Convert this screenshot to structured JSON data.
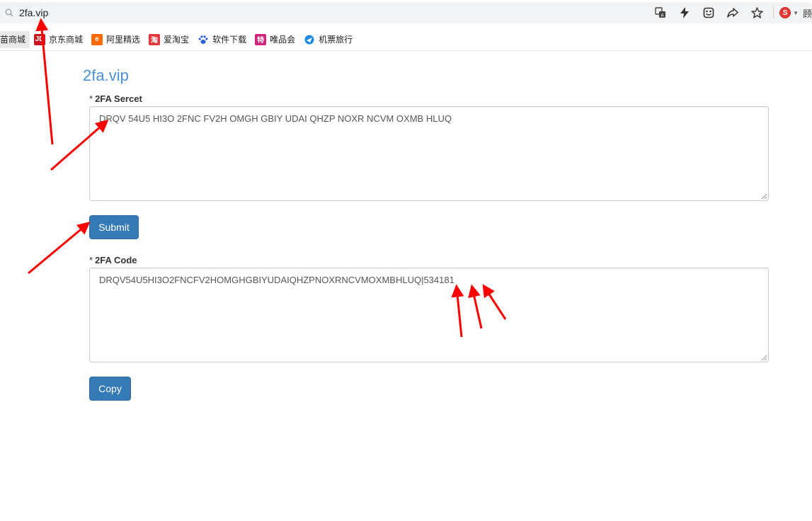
{
  "browser": {
    "url": "2fa.vip",
    "toolbar_icons": [
      "translate-icon",
      "bolt-icon",
      "extension-icon",
      "share-icon",
      "star-icon"
    ],
    "user_label": "顾"
  },
  "bookmarks": [
    {
      "label": "苗商城",
      "icon": "tmall-icon",
      "color": "#e5e5e5"
    },
    {
      "label": "京东商城",
      "icon": "jd-icon",
      "icon_text": "JD",
      "color": "#c91623"
    },
    {
      "label": "阿里精选",
      "icon": "aliexpress-icon",
      "icon_text": "e",
      "color": "#ff6a00"
    },
    {
      "label": "爱淘宝",
      "icon": "taobao-icon",
      "icon_text": "淘",
      "color": "#e4393c"
    },
    {
      "label": "软件下载",
      "icon": "paw-icon",
      "color": "#2e5fd6"
    },
    {
      "label": "唯品会",
      "icon": "vip-icon",
      "icon_text": "特",
      "color": "#d4237a"
    },
    {
      "label": "机票旅行",
      "icon": "travel-icon",
      "color": "#1e88e5"
    }
  ],
  "page": {
    "title": "2fa.vip",
    "secret": {
      "required_mark": "*",
      "label": "2FA Sercet",
      "value": "DRQV 54U5 HI3O 2FNC FV2H OMGH GBIY UDAI QHZP NOXR NCVM OXMB HLUQ"
    },
    "submit_label": "Submit",
    "code": {
      "required_mark": "*",
      "label": "2FA Code",
      "value": "DRQV54U5HI3O2FNCFV2HOMGHGBIYUDAIQHZPNOXRNCVMOXMBHLUQ|534181"
    },
    "copy_label": "Copy"
  },
  "colors": {
    "accent": "#337ab7",
    "title": "#4a90d9",
    "annotation": "#ff0000"
  }
}
